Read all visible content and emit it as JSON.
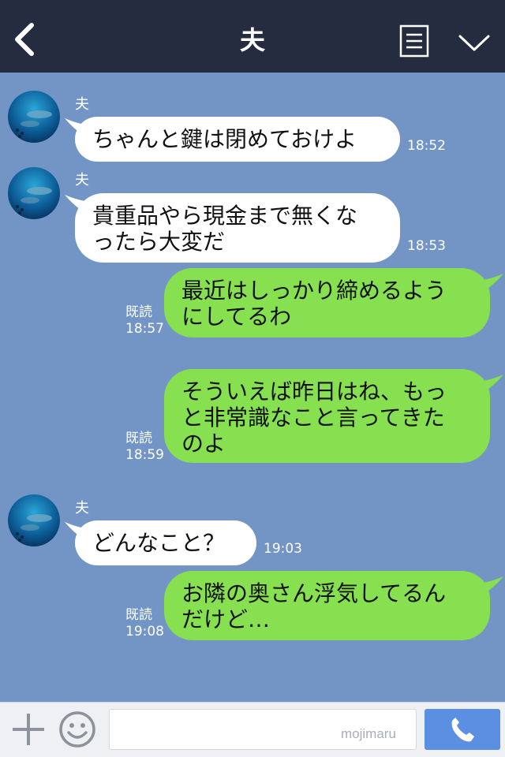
{
  "header": {
    "title": "夫",
    "back_icon": "chevron-left-icon",
    "menu_icon": "list-icon",
    "expand_icon": "chevron-down-icon",
    "background": "#252c3f"
  },
  "chat": {
    "background": "#7395c5",
    "messages": [
      {
        "direction": "in",
        "sender": "夫",
        "lines": [
          "ちゃんと鍵は閉めておけよ"
        ],
        "time": "18:52"
      },
      {
        "direction": "in",
        "sender": "夫",
        "lines": [
          "貴重品やら現金まで無くな",
          "ったら大変だ"
        ],
        "time": "18:53"
      },
      {
        "direction": "out",
        "lines": [
          "最近はしっかり締めるよう",
          "にしてるわ"
        ],
        "read": "既読",
        "time": "18:57"
      },
      {
        "direction": "out",
        "lines": [
          "そういえば昨日はね、もっ",
          "と非常識なこと言ってきた",
          "のよ"
        ],
        "read": "既読",
        "time": "18:59"
      },
      {
        "direction": "in",
        "sender": "夫",
        "lines": [
          "どんなこと？"
        ],
        "time": "19:03"
      },
      {
        "direction": "out",
        "lines": [
          "お隣の奥さん浮気してるん",
          "だけど…"
        ],
        "read": "既読",
        "time": "19:08"
      }
    ]
  },
  "input_bar": {
    "plus_icon": "plus-icon",
    "emoji_icon": "smiley-icon",
    "message_value": "",
    "watermark": "mojimaru",
    "call_icon": "phone-icon",
    "call_color": "#5b8fe1"
  },
  "colors": {
    "incoming_bubble": "#ffffff",
    "outgoing_bubble": "#86e04f"
  }
}
